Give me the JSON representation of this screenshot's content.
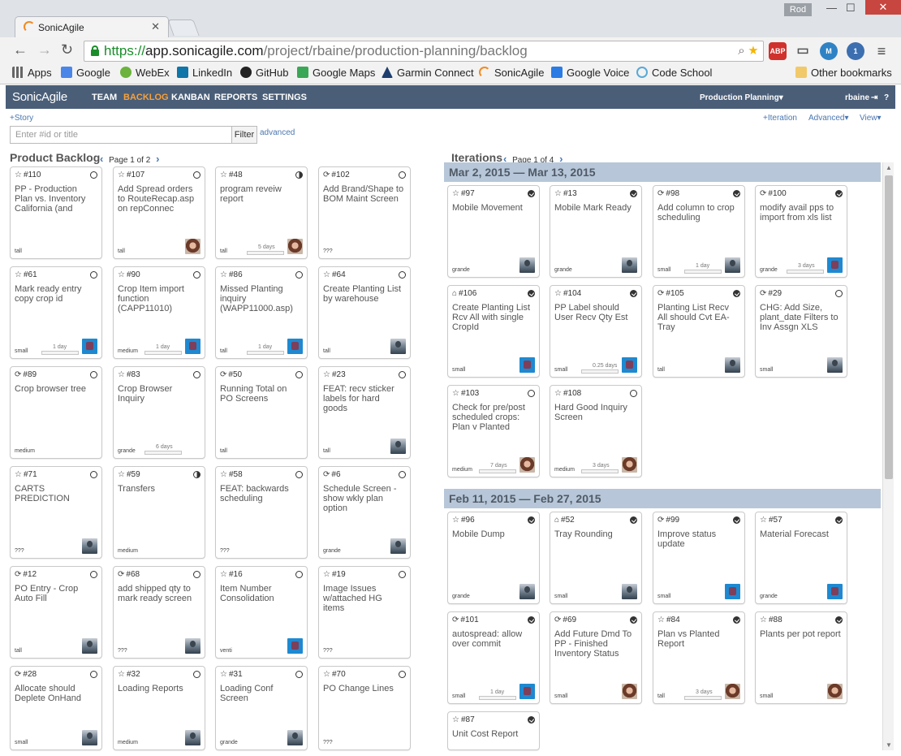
{
  "browser": {
    "tab_title": "SonicAgile",
    "profile": "Rod",
    "url_scheme": "https://",
    "url_host": "app.sonicagile.com",
    "url_path": "/project/rbaine/production-planning/backlog",
    "bookmarks": [
      "Apps",
      "Google",
      "WebEx",
      "LinkedIn",
      "GitHub",
      "Google Maps",
      "Garmin Connect",
      "SonicAgile",
      "Google Voice",
      "Code School"
    ],
    "other_bookmarks": "Other bookmarks",
    "ext_abp": "ABP",
    "ext_badge": "1"
  },
  "app": {
    "brand": "SonicAgile",
    "nav": [
      "TEAM",
      "BACKLOG",
      "KANBAN",
      "REPORTS",
      "SETTINGS"
    ],
    "project": "Production Planning▾",
    "user": "rbaine",
    "help": "?"
  },
  "subbar": {
    "add_story": "+Story",
    "search_placeholder": "Enter #id or title",
    "filter": "Filter",
    "advanced": "advanced",
    "iteration": "+Iteration",
    "advanced_menu": "Advanced▾",
    "view_menu": "View▾"
  },
  "backlog": {
    "title": "Product Backlog",
    "pager": "Page 1 of 2",
    "cards": [
      {
        "id": "#110",
        "kind": "☆",
        "status": "open",
        "title": "PP - Production Plan vs. Inventory California (and",
        "size": "tall",
        "est": "",
        "avatar": ""
      },
      {
        "id": "#107",
        "kind": "☆",
        "status": "open",
        "title": "Add Spread orders to RouteRecap.asp on repConnec",
        "size": "tall",
        "est": "",
        "avatar": "woman"
      },
      {
        "id": "#48",
        "kind": "☆",
        "status": "half",
        "title": "program reveiw report",
        "size": "tall",
        "est": "5 days",
        "avatar": "woman"
      },
      {
        "id": "#102",
        "kind": "⟳",
        "status": "open",
        "title": "Add Brand/Shape to BOM Maint Screen",
        "size": "???",
        "est": "",
        "avatar": ""
      },
      {
        "id": "#61",
        "kind": "☆",
        "status": "open",
        "title": "Mark ready entry copy crop id",
        "size": "small",
        "est": "1 day",
        "avatar": "blue"
      },
      {
        "id": "#90",
        "kind": "☆",
        "status": "open",
        "title": "Crop Item import function (CAPP11010)",
        "size": "medium",
        "est": "1 day",
        "avatar": "blue"
      },
      {
        "id": "#86",
        "kind": "☆",
        "status": "open",
        "title": "Missed Planting inquiry (WAPP11000.asp)",
        "size": "tall",
        "est": "1 day",
        "avatar": "blue"
      },
      {
        "id": "#64",
        "kind": "☆",
        "status": "open",
        "title": "Create Planting List by warehouse",
        "size": "tall",
        "est": "",
        "avatar": "man"
      },
      {
        "id": "#89",
        "kind": "⟳",
        "status": "open",
        "title": "Crop browser tree",
        "size": "medium",
        "est": "",
        "avatar": ""
      },
      {
        "id": "#83",
        "kind": "☆",
        "status": "open",
        "title": "Crop Browser Inquiry",
        "size": "grande",
        "est": "6 days",
        "avatar": ""
      },
      {
        "id": "#50",
        "kind": "⟳",
        "status": "open",
        "title": "Running Total on PO Screens",
        "size": "tall",
        "est": "",
        "avatar": ""
      },
      {
        "id": "#23",
        "kind": "☆",
        "status": "open",
        "title": "FEAT: recv sticker labels for hard goods",
        "size": "tall",
        "est": "",
        "avatar": "man"
      },
      {
        "id": "#71",
        "kind": "☆",
        "status": "open",
        "title": "CARTS PREDICTION",
        "size": "???",
        "est": "",
        "avatar": "man"
      },
      {
        "id": "#59",
        "kind": "☆",
        "status": "half",
        "title": "Transfers",
        "size": "medium",
        "est": "",
        "avatar": ""
      },
      {
        "id": "#58",
        "kind": "☆",
        "status": "open",
        "title": "FEAT: backwards scheduling",
        "size": "???",
        "est": "",
        "avatar": ""
      },
      {
        "id": "#6",
        "kind": "⟳",
        "status": "open",
        "title": "Schedule Screen - show wkly plan option",
        "size": "grande",
        "est": "",
        "avatar": "man"
      },
      {
        "id": "#12",
        "kind": "⟳",
        "status": "open",
        "title": "PO Entry - Crop Auto Fill",
        "size": "tall",
        "est": "",
        "avatar": "man"
      },
      {
        "id": "#68",
        "kind": "⟳",
        "status": "open",
        "title": "add shipped qty to mark ready screen",
        "size": "???",
        "est": "",
        "avatar": "man"
      },
      {
        "id": "#16",
        "kind": "☆",
        "status": "open",
        "title": "Item Number Consolidation",
        "size": "venti",
        "est": "",
        "avatar": "blue"
      },
      {
        "id": "#19",
        "kind": "☆",
        "status": "open",
        "title": "Image Issues w/attached HG items",
        "size": "???",
        "est": "",
        "avatar": ""
      },
      {
        "id": "#28",
        "kind": "⟳",
        "status": "open",
        "title": "Allocate should Deplete OnHand",
        "size": "small",
        "est": "",
        "avatar": "man"
      },
      {
        "id": "#32",
        "kind": "☆",
        "status": "open",
        "title": "Loading Reports",
        "size": "medium",
        "est": "",
        "avatar": "man"
      },
      {
        "id": "#31",
        "kind": "☆",
        "status": "open",
        "title": "Loading Conf Screen",
        "size": "grande",
        "est": "",
        "avatar": "man"
      },
      {
        "id": "#70",
        "kind": "☆",
        "status": "open",
        "title": "PO Change Lines",
        "size": "???",
        "est": "",
        "avatar": ""
      }
    ]
  },
  "iterations": {
    "title": "Iterations",
    "pager": "Page 1 of 4",
    "groups": [
      {
        "range": "Mar 2, 2015 — Mar 13, 2015",
        "cards": [
          {
            "id": "#97",
            "kind": "☆",
            "status": "done",
            "title": "Mobile Movement",
            "size": "grande",
            "est": "",
            "avatar": "man"
          },
          {
            "id": "#13",
            "kind": "☆",
            "status": "done",
            "title": "Mobile Mark Ready",
            "size": "grande",
            "est": "",
            "avatar": "man"
          },
          {
            "id": "#98",
            "kind": "⟳",
            "status": "done",
            "title": "Add column to crop scheduling",
            "size": "small",
            "est": "1 day",
            "avatar": "man"
          },
          {
            "id": "#100",
            "kind": "⟳",
            "status": "done",
            "title": "modify avail pps to import from xls list",
            "size": "grande",
            "est": "3 days",
            "avatar": "blue"
          },
          {
            "id": "#106",
            "kind": "⌂",
            "status": "done",
            "title": "Create Planting List Rcv All with single CropId",
            "size": "small",
            "est": "",
            "avatar": "blue"
          },
          {
            "id": "#104",
            "kind": "☆",
            "status": "done",
            "title": "PP Label should User Recv Qty Est",
            "size": "small",
            "est": "0.25 days",
            "avatar": "blue"
          },
          {
            "id": "#105",
            "kind": "⟳",
            "status": "done",
            "title": "Planting List Recv All should Cvt EA-Tray",
            "size": "tall",
            "est": "",
            "avatar": "man"
          },
          {
            "id": "#29",
            "kind": "⟳",
            "status": "open",
            "title": "CHG: Add Size, plant_date Filters to Inv Assgn XLS",
            "size": "small",
            "est": "",
            "avatar": "man"
          },
          {
            "id": "#103",
            "kind": "☆",
            "status": "open",
            "title": "Check for pre/post scheduled crops: Plan v Planted",
            "size": "medium",
            "est": "7 days",
            "avatar": "woman"
          },
          {
            "id": "#108",
            "kind": "☆",
            "status": "open",
            "title": "Hard Good Inquiry Screen",
            "size": "medium",
            "est": "3 days",
            "avatar": "woman"
          }
        ]
      },
      {
        "range": "Feb 11, 2015 — Feb 27, 2015",
        "cards": [
          {
            "id": "#96",
            "kind": "☆",
            "status": "done",
            "title": "Mobile Dump",
            "size": "grande",
            "est": "",
            "avatar": "man"
          },
          {
            "id": "#52",
            "kind": "⌂",
            "status": "done",
            "title": "Tray Rounding",
            "size": "small",
            "est": "",
            "avatar": "man"
          },
          {
            "id": "#99",
            "kind": "⟳",
            "status": "done",
            "title": "Improve status update",
            "size": "small",
            "est": "",
            "avatar": "blue"
          },
          {
            "id": "#57",
            "kind": "☆",
            "status": "done",
            "title": "Material Forecast",
            "size": "grande",
            "est": "",
            "avatar": "blue"
          },
          {
            "id": "#101",
            "kind": "⟳",
            "status": "done",
            "title": "autospread: allow over commit",
            "size": "small",
            "est": "1 day",
            "avatar": "blue"
          },
          {
            "id": "#69",
            "kind": "⟳",
            "status": "done",
            "title": "Add Future Dmd To PP - Finished Inventory Status",
            "size": "small",
            "est": "",
            "avatar": "woman"
          },
          {
            "id": "#84",
            "kind": "☆",
            "status": "done",
            "title": "Plan vs Planted Report",
            "size": "tall",
            "est": "3 days",
            "avatar": "woman"
          },
          {
            "id": "#88",
            "kind": "☆",
            "status": "done",
            "title": "Plants per pot report",
            "size": "small",
            "est": "",
            "avatar": "woman"
          },
          {
            "id": "#87",
            "kind": "☆",
            "status": "done",
            "title": "Unit Cost Report",
            "size": "",
            "est": "",
            "avatar": ""
          }
        ]
      }
    ]
  }
}
